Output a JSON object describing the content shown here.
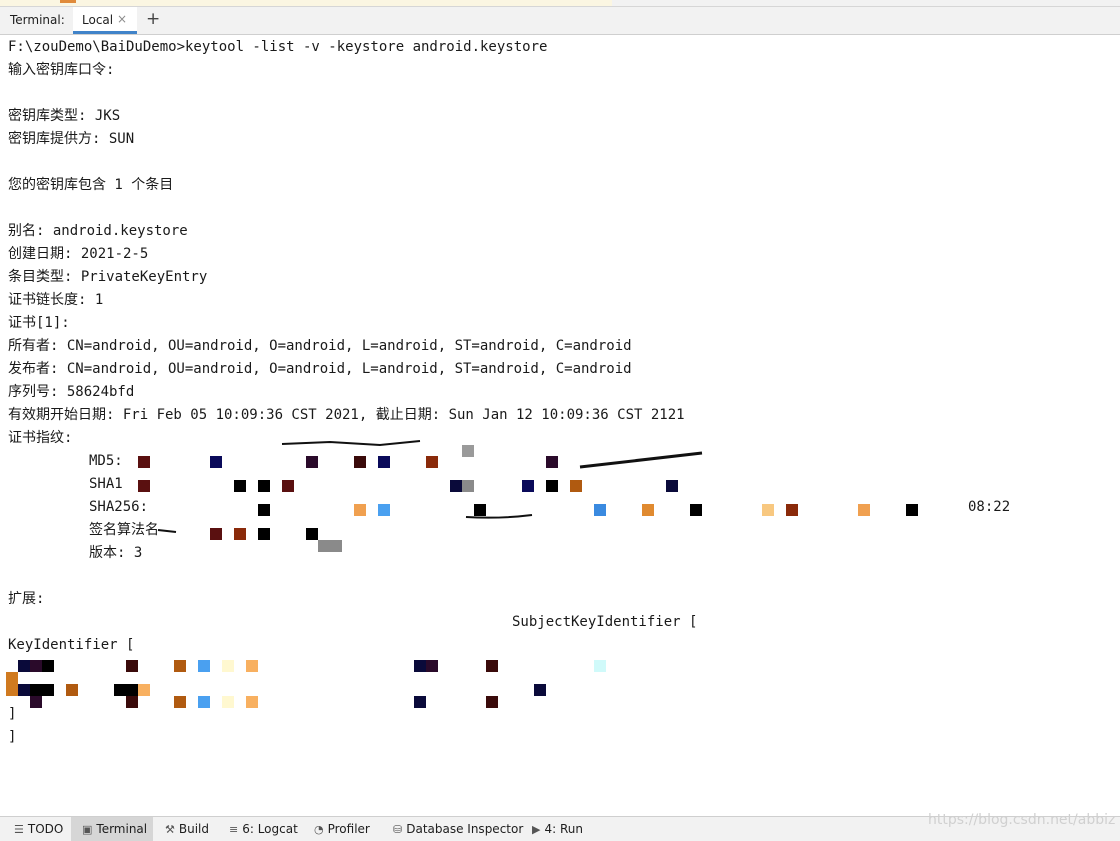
{
  "terminal": {
    "label": "Terminal:",
    "active_tab": "Local",
    "close_glyph": "×",
    "add_glyph": "+"
  },
  "output": {
    "command": "F:\\zouDemo\\BaiDuDemo>keytool -list -v -keystore android.keystore",
    "prompt": "输入密钥库口令:",
    "keystore_type": "密钥库类型: JKS",
    "keystore_provider": "密钥库提供方: SUN",
    "entry_count": "您的密钥库包含 1 个条目",
    "alias": "别名: android.keystore",
    "created": "创建日期: 2021-2-5",
    "entry_type": "条目类型: PrivateKeyEntry",
    "chain_length": "证书链长度: 1",
    "cert_index": "证书[1]:",
    "owner": "所有者: CN=android, OU=android, O=android, L=android, ST=android, C=android",
    "issuer": "发布者: CN=android, OU=android, O=android, L=android, ST=android, C=android",
    "serial": "序列号: 58624bfd",
    "validity": "有效期开始日期: Fri Feb 05 10:09:36 CST 2021, 截止日期: Sun Jan 12 10:09:36 CST 2121",
    "fingerprints_label": "证书指纹:",
    "md5_label": "MD5:",
    "sha1_label": "SHA1",
    "sha256_label": "SHA256:",
    "sha256_tail": "08:22",
    "sig_alg_label": "签名算法名",
    "version": "版本: 3",
    "extensions_label": "扩展:",
    "subject_key_id": "SubjectKeyIdentifier [",
    "key_identifier": "KeyIdentifier [",
    "close_bracket_1": "]",
    "close_bracket_2": "]"
  },
  "bottom_tools": [
    {
      "icon": "list-icon",
      "label": "TODO"
    },
    {
      "icon": "terminal-icon",
      "label": "Terminal"
    },
    {
      "icon": "hammer-icon",
      "label": "Build"
    },
    {
      "icon": "logcat-icon",
      "label": "6: Logcat"
    },
    {
      "icon": "gauge-icon",
      "label": "Profiler"
    },
    {
      "icon": "database-icon",
      "label": "Database Inspector"
    },
    {
      "icon": "run-icon",
      "label": "4: Run"
    }
  ],
  "watermark": "https://blog.csdn.net/abbiz",
  "colors": {
    "tab_underline": "#4083c9",
    "text": "#1a1a1a",
    "toolbar_bg": "#f2f2f2"
  }
}
